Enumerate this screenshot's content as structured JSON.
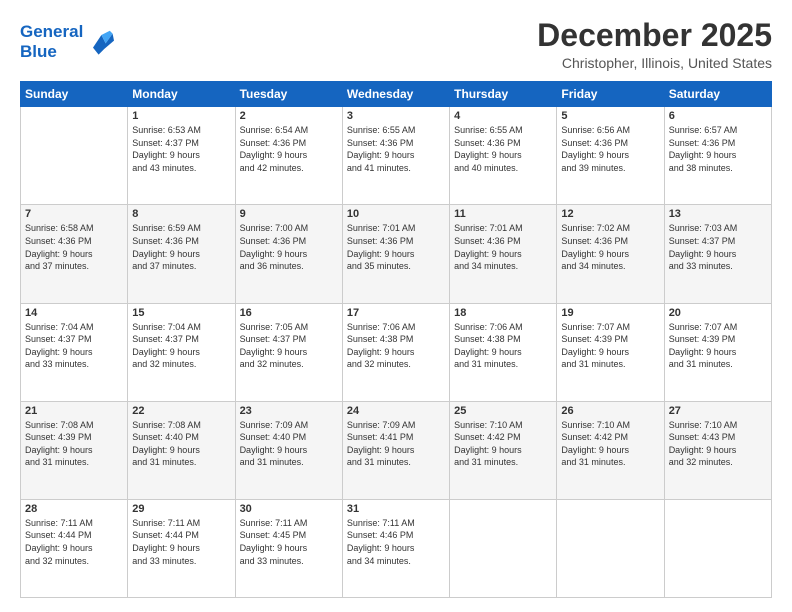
{
  "header": {
    "logo_line1": "General",
    "logo_line2": "Blue",
    "title": "December 2025",
    "subtitle": "Christopher, Illinois, United States"
  },
  "days_of_week": [
    "Sunday",
    "Monday",
    "Tuesday",
    "Wednesday",
    "Thursday",
    "Friday",
    "Saturday"
  ],
  "weeks": [
    [
      {
        "day": "",
        "info": ""
      },
      {
        "day": "1",
        "info": "Sunrise: 6:53 AM\nSunset: 4:37 PM\nDaylight: 9 hours\nand 43 minutes."
      },
      {
        "day": "2",
        "info": "Sunrise: 6:54 AM\nSunset: 4:36 PM\nDaylight: 9 hours\nand 42 minutes."
      },
      {
        "day": "3",
        "info": "Sunrise: 6:55 AM\nSunset: 4:36 PM\nDaylight: 9 hours\nand 41 minutes."
      },
      {
        "day": "4",
        "info": "Sunrise: 6:55 AM\nSunset: 4:36 PM\nDaylight: 9 hours\nand 40 minutes."
      },
      {
        "day": "5",
        "info": "Sunrise: 6:56 AM\nSunset: 4:36 PM\nDaylight: 9 hours\nand 39 minutes."
      },
      {
        "day": "6",
        "info": "Sunrise: 6:57 AM\nSunset: 4:36 PM\nDaylight: 9 hours\nand 38 minutes."
      }
    ],
    [
      {
        "day": "7",
        "info": "Sunrise: 6:58 AM\nSunset: 4:36 PM\nDaylight: 9 hours\nand 37 minutes."
      },
      {
        "day": "8",
        "info": "Sunrise: 6:59 AM\nSunset: 4:36 PM\nDaylight: 9 hours\nand 37 minutes."
      },
      {
        "day": "9",
        "info": "Sunrise: 7:00 AM\nSunset: 4:36 PM\nDaylight: 9 hours\nand 36 minutes."
      },
      {
        "day": "10",
        "info": "Sunrise: 7:01 AM\nSunset: 4:36 PM\nDaylight: 9 hours\nand 35 minutes."
      },
      {
        "day": "11",
        "info": "Sunrise: 7:01 AM\nSunset: 4:36 PM\nDaylight: 9 hours\nand 34 minutes."
      },
      {
        "day": "12",
        "info": "Sunrise: 7:02 AM\nSunset: 4:36 PM\nDaylight: 9 hours\nand 34 minutes."
      },
      {
        "day": "13",
        "info": "Sunrise: 7:03 AM\nSunset: 4:37 PM\nDaylight: 9 hours\nand 33 minutes."
      }
    ],
    [
      {
        "day": "14",
        "info": "Sunrise: 7:04 AM\nSunset: 4:37 PM\nDaylight: 9 hours\nand 33 minutes."
      },
      {
        "day": "15",
        "info": "Sunrise: 7:04 AM\nSunset: 4:37 PM\nDaylight: 9 hours\nand 32 minutes."
      },
      {
        "day": "16",
        "info": "Sunrise: 7:05 AM\nSunset: 4:37 PM\nDaylight: 9 hours\nand 32 minutes."
      },
      {
        "day": "17",
        "info": "Sunrise: 7:06 AM\nSunset: 4:38 PM\nDaylight: 9 hours\nand 32 minutes."
      },
      {
        "day": "18",
        "info": "Sunrise: 7:06 AM\nSunset: 4:38 PM\nDaylight: 9 hours\nand 31 minutes."
      },
      {
        "day": "19",
        "info": "Sunrise: 7:07 AM\nSunset: 4:39 PM\nDaylight: 9 hours\nand 31 minutes."
      },
      {
        "day": "20",
        "info": "Sunrise: 7:07 AM\nSunset: 4:39 PM\nDaylight: 9 hours\nand 31 minutes."
      }
    ],
    [
      {
        "day": "21",
        "info": "Sunrise: 7:08 AM\nSunset: 4:39 PM\nDaylight: 9 hours\nand 31 minutes."
      },
      {
        "day": "22",
        "info": "Sunrise: 7:08 AM\nSunset: 4:40 PM\nDaylight: 9 hours\nand 31 minutes."
      },
      {
        "day": "23",
        "info": "Sunrise: 7:09 AM\nSunset: 4:40 PM\nDaylight: 9 hours\nand 31 minutes."
      },
      {
        "day": "24",
        "info": "Sunrise: 7:09 AM\nSunset: 4:41 PM\nDaylight: 9 hours\nand 31 minutes."
      },
      {
        "day": "25",
        "info": "Sunrise: 7:10 AM\nSunset: 4:42 PM\nDaylight: 9 hours\nand 31 minutes."
      },
      {
        "day": "26",
        "info": "Sunrise: 7:10 AM\nSunset: 4:42 PM\nDaylight: 9 hours\nand 31 minutes."
      },
      {
        "day": "27",
        "info": "Sunrise: 7:10 AM\nSunset: 4:43 PM\nDaylight: 9 hours\nand 32 minutes."
      }
    ],
    [
      {
        "day": "28",
        "info": "Sunrise: 7:11 AM\nSunset: 4:44 PM\nDaylight: 9 hours\nand 32 minutes."
      },
      {
        "day": "29",
        "info": "Sunrise: 7:11 AM\nSunset: 4:44 PM\nDaylight: 9 hours\nand 33 minutes."
      },
      {
        "day": "30",
        "info": "Sunrise: 7:11 AM\nSunset: 4:45 PM\nDaylight: 9 hours\nand 33 minutes."
      },
      {
        "day": "31",
        "info": "Sunrise: 7:11 AM\nSunset: 4:46 PM\nDaylight: 9 hours\nand 34 minutes."
      },
      {
        "day": "",
        "info": ""
      },
      {
        "day": "",
        "info": ""
      },
      {
        "day": "",
        "info": ""
      }
    ]
  ]
}
